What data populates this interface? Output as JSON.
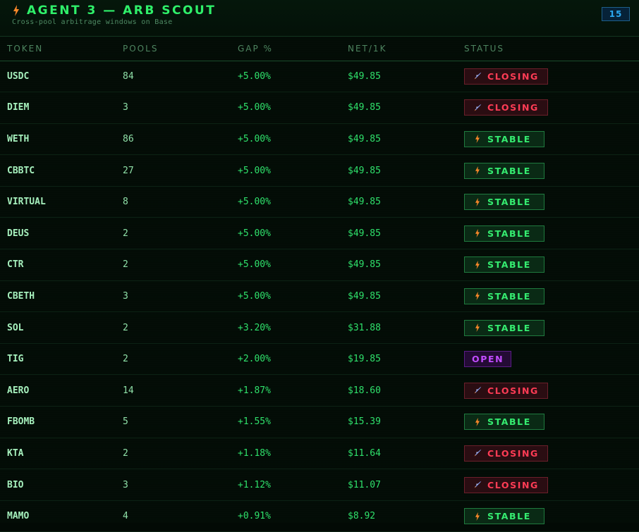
{
  "header": {
    "title": "Agent 3 — Arb Scout",
    "subtitle": "Cross-pool arbitrage windows on Base",
    "count": "15"
  },
  "columns": [
    "TOKEN",
    "POOLS",
    "GAP %",
    "NET/1K",
    "STATUS"
  ],
  "colors": {
    "closing": "#ff3c55",
    "stable": "#35ec70",
    "open": "#c24cff",
    "accent": "#2ff06a",
    "bolt": "#ff8a2a"
  },
  "icons": {
    "title": "lightning-bolt-icon",
    "stable": "lightning-bolt-icon",
    "closing": "rocket-icon"
  },
  "rows": [
    {
      "token": "USDC",
      "pools": "84",
      "gap": "+5.00%",
      "net": "$49.85",
      "status": "CLOSING",
      "kind": "closing"
    },
    {
      "token": "DIEM",
      "pools": "3",
      "gap": "+5.00%",
      "net": "$49.85",
      "status": "CLOSING",
      "kind": "closing"
    },
    {
      "token": "WETH",
      "pools": "86",
      "gap": "+5.00%",
      "net": "$49.85",
      "status": "STABLE",
      "kind": "stable"
    },
    {
      "token": "CBBTC",
      "pools": "27",
      "gap": "+5.00%",
      "net": "$49.85",
      "status": "STABLE",
      "kind": "stable"
    },
    {
      "token": "VIRTUAL",
      "pools": "8",
      "gap": "+5.00%",
      "net": "$49.85",
      "status": "STABLE",
      "kind": "stable"
    },
    {
      "token": "DEUS",
      "pools": "2",
      "gap": "+5.00%",
      "net": "$49.85",
      "status": "STABLE",
      "kind": "stable"
    },
    {
      "token": "CTR",
      "pools": "2",
      "gap": "+5.00%",
      "net": "$49.85",
      "status": "STABLE",
      "kind": "stable"
    },
    {
      "token": "CBETH",
      "pools": "3",
      "gap": "+5.00%",
      "net": "$49.85",
      "status": "STABLE",
      "kind": "stable"
    },
    {
      "token": "SOL",
      "pools": "2",
      "gap": "+3.20%",
      "net": "$31.88",
      "status": "STABLE",
      "kind": "stable"
    },
    {
      "token": "TIG",
      "pools": "2",
      "gap": "+2.00%",
      "net": "$19.85",
      "status": "OPEN",
      "kind": "open"
    },
    {
      "token": "AERO",
      "pools": "14",
      "gap": "+1.87%",
      "net": "$18.60",
      "status": "CLOSING",
      "kind": "closing"
    },
    {
      "token": "FBOMB",
      "pools": "5",
      "gap": "+1.55%",
      "net": "$15.39",
      "status": "STABLE",
      "kind": "stable"
    },
    {
      "token": "KTA",
      "pools": "2",
      "gap": "+1.18%",
      "net": "$11.64",
      "status": "CLOSING",
      "kind": "closing"
    },
    {
      "token": "BIO",
      "pools": "3",
      "gap": "+1.12%",
      "net": "$11.07",
      "status": "CLOSING",
      "kind": "closing"
    },
    {
      "token": "MAMO",
      "pools": "4",
      "gap": "+0.91%",
      "net": "$8.92",
      "status": "STABLE",
      "kind": "stable"
    }
  ]
}
